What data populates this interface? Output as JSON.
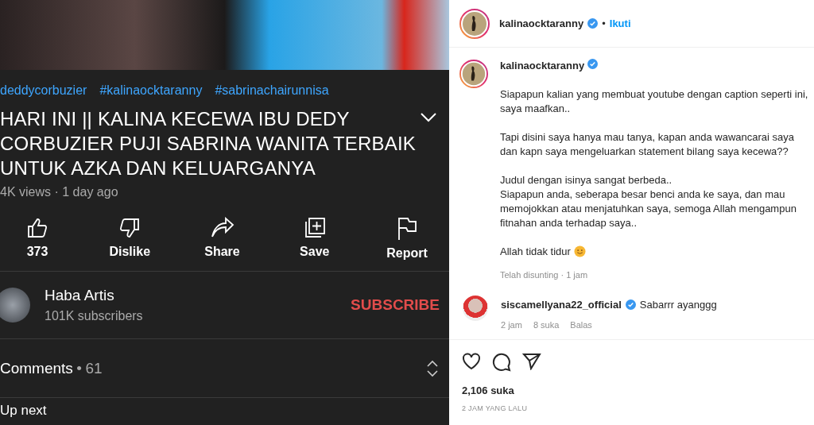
{
  "video": {
    "hashtags": [
      "deddycorbuzier",
      "#kalinaocktaranny",
      "#sabrinachairunnisa"
    ],
    "title_lines": [
      "HARI INI || KALINA KECEWA IBU DEDY",
      "CORBUZIER PUJI SABRINA WANITA TERBAIK",
      "UNTUK AZKA DAN KELUARGANYA"
    ],
    "views": "4K views · 1 day ago",
    "actions": [
      {
        "kind": "like",
        "label": "373"
      },
      {
        "kind": "dislike",
        "label": "Dislike"
      },
      {
        "kind": "share",
        "label": "Share"
      },
      {
        "kind": "save",
        "label": "Save"
      },
      {
        "kind": "report",
        "label": "Report"
      }
    ],
    "channel": {
      "name": "Haba Artis",
      "subscribers": "101K subscribers",
      "subscribe": "SUBSCRIBE"
    },
    "comments": {
      "label": "Comments",
      "separator": "•",
      "count": "61"
    },
    "up_next": "Up next"
  },
  "post": {
    "header": {
      "username": "kalinaocktaranny",
      "verified": true,
      "separator": "•",
      "follow": "Ikuti"
    },
    "caption": {
      "username": "kalinaocktaranny",
      "verified": true,
      "paragraphs": [
        "Siapapun kalian yang membuat youtube dengan caption seperti ini, saya maafkan..",
        "Tapi disini saya hanya mau tanya, kapan anda wawancarai saya dan kapn saya mengeluarkan statement bilang saya kecewa??",
        "Judul dengan isinya sangat berbeda..\nSiapapun anda, seberapa besar benci anda ke saya, dan mau memojokkan atau menjatuhkan saya, semoga Allah mengampun fitnahan anda terhadap saya..",
        "Allah tidak tidur"
      ],
      "meta": "Telah disunting · 1 jam"
    },
    "comments": [
      {
        "username": "siscamellyana22_official",
        "verified": true,
        "text": "Sabarrr ayanggg",
        "time": "2 jam",
        "likes": "8 suka",
        "reply": "Balas"
      }
    ],
    "likes": "2,106 suka",
    "time": "2 JAM YANG LALU"
  }
}
